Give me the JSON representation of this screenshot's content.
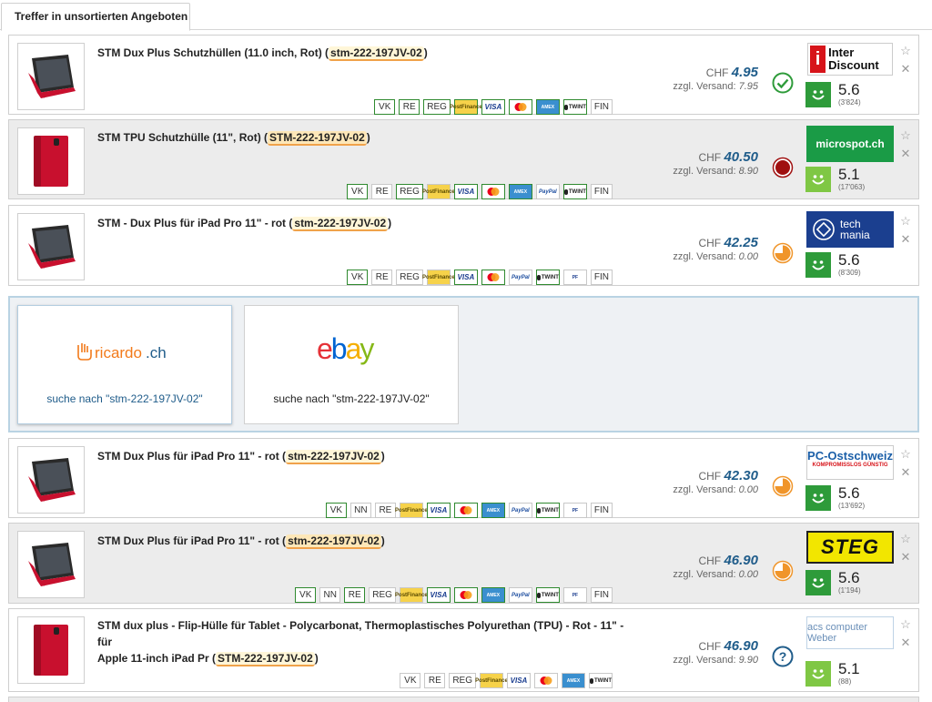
{
  "tab": {
    "label": "Treffer in unsortierten Angeboten"
  },
  "offers": [
    {
      "title": "STM Dux Plus Schutzhüllen (11.0 inch, Rot) (",
      "sku": "stm-222-197JV-02",
      "title_end": ")",
      "title_cont": "",
      "currency": "CHF",
      "price": "4.95",
      "shipping_label": "zzgl. Versand:",
      "shipping": "7.95",
      "status": "check",
      "shop": "Inter Discount",
      "rating": "5.6",
      "reviews": "(3'824)",
      "chips": [
        {
          "t": "VK",
          "g": true
        },
        {
          "t": "RE",
          "g": true
        },
        {
          "t": "REG",
          "g": true
        },
        {
          "t": "PostFinance",
          "c": "pp",
          "g": true
        },
        {
          "t": "VISA",
          "c": "visa",
          "g": true
        },
        {
          "t": "MC",
          "c": "mc",
          "g": true
        },
        {
          "t": "AMEX",
          "c": "ae",
          "g": true
        },
        {
          "t": "TWINT",
          "c": "tw",
          "g": true
        },
        {
          "t": "FIN",
          "g": false
        }
      ]
    },
    {
      "title": "STM TPU Schutzhülle (11\", Rot) (",
      "sku": "STM-222-197JV-02",
      "title_end": ")",
      "title_cont": "",
      "currency": "CHF",
      "price": "40.50",
      "shipping_label": "zzgl. Versand:",
      "shipping": "8.90",
      "status": "red",
      "shop": "microspot.ch",
      "rating": "5.1",
      "reviews": "(17'063)",
      "chips": [
        {
          "t": "VK",
          "g": true
        },
        {
          "t": "RE",
          "g": false
        },
        {
          "t": "REG",
          "g": true
        },
        {
          "t": "PostFinance",
          "c": "pp",
          "g": false
        },
        {
          "t": "VISA",
          "c": "visa",
          "g": true
        },
        {
          "t": "MC",
          "c": "mc",
          "g": true
        },
        {
          "t": "AMEX",
          "c": "ae",
          "g": true
        },
        {
          "t": "PayPal",
          "c": "pay",
          "g": false
        },
        {
          "t": "TWINT",
          "c": "tw",
          "g": true
        },
        {
          "t": "FIN",
          "g": false
        }
      ]
    },
    {
      "title": "STM - Dux Plus für iPad Pro 11\" - rot (",
      "sku": "stm-222-197JV-02",
      "title_end": ")",
      "title_cont": "",
      "currency": "CHF",
      "price": "42.25",
      "shipping_label": "zzgl. Versand:",
      "shipping": "0.00",
      "status": "orange",
      "shop": "tech mania",
      "rating": "5.6",
      "reviews": "(8'309)",
      "chips": [
        {
          "t": "VK",
          "g": true
        },
        {
          "t": "RE",
          "g": false
        },
        {
          "t": "REG",
          "g": false
        },
        {
          "t": "PostFinance",
          "c": "pp",
          "g": false
        },
        {
          "t": "VISA",
          "c": "visa",
          "g": true
        },
        {
          "t": "MC",
          "c": "mc",
          "g": true
        },
        {
          "t": "PayPal",
          "c": "pay",
          "g": false
        },
        {
          "t": "TWINT",
          "c": "tw",
          "g": true
        },
        {
          "t": "PF",
          "c": "pf",
          "g": false
        },
        {
          "t": "FIN",
          "g": false
        }
      ]
    },
    {
      "title": "STM Dux Plus für iPad Pro 11\" - rot (",
      "sku": "stm-222-197JV-02",
      "title_end": ")",
      "title_cont": "",
      "currency": "CHF",
      "price": "42.30",
      "shipping_label": "zzgl. Versand:",
      "shipping": "0.00",
      "status": "orange",
      "shop": "PC-Ostschweiz",
      "shop_sub": "KOMPROMISSLOS GÜNSTIG",
      "rating": "5.6",
      "reviews": "(13'692)",
      "chips": [
        {
          "t": "VK",
          "g": true
        },
        {
          "t": "NN",
          "g": false
        },
        {
          "t": "RE",
          "g": false
        },
        {
          "t": "PostFinance",
          "c": "pp",
          "g": false
        },
        {
          "t": "VISA",
          "c": "visa",
          "g": true
        },
        {
          "t": "MC",
          "c": "mc",
          "g": true
        },
        {
          "t": "AMEX",
          "c": "ae",
          "g": true
        },
        {
          "t": "PayPal",
          "c": "pay",
          "g": false
        },
        {
          "t": "TWINT",
          "c": "tw",
          "g": true
        },
        {
          "t": "PF",
          "c": "pf",
          "g": false
        },
        {
          "t": "FIN",
          "g": false
        }
      ]
    },
    {
      "title": "STM Dux Plus für iPad Pro 11\" - rot (",
      "sku": "stm-222-197JV-02",
      "title_end": ")",
      "title_cont": "",
      "currency": "CHF",
      "price": "46.90",
      "shipping_label": "zzgl. Versand:",
      "shipping": "0.00",
      "status": "orange",
      "shop": "STEG",
      "rating": "5.6",
      "reviews": "(1'194)",
      "chips": [
        {
          "t": "VK",
          "g": true
        },
        {
          "t": "NN",
          "g": false
        },
        {
          "t": "RE",
          "g": true
        },
        {
          "t": "REG",
          "g": false
        },
        {
          "t": "PostFinance",
          "c": "pp",
          "g": false
        },
        {
          "t": "VISA",
          "c": "visa",
          "g": true
        },
        {
          "t": "MC",
          "c": "mc",
          "g": true
        },
        {
          "t": "AMEX",
          "c": "ae",
          "g": true
        },
        {
          "t": "PayPal",
          "c": "pay",
          "g": false
        },
        {
          "t": "TWINT",
          "c": "tw",
          "g": true
        },
        {
          "t": "PF",
          "c": "pf",
          "g": false
        },
        {
          "t": "FIN",
          "g": false
        }
      ]
    },
    {
      "title": "STM dux plus - Flip-Hülle für Tablet - Polycarbonat, Thermoplastisches Polyurethan (TPU) - Rot - 11\" - für",
      "title_cont": "Apple 11-inch iPad Pr (",
      "sku": "STM-222-197JV-02",
      "title_end": ")",
      "currency": "CHF",
      "price": "46.90",
      "shipping_label": "zzgl. Versand:",
      "shipping": "9.90",
      "status": "question",
      "shop": "acs computer Weber",
      "rating": "5.1",
      "reviews": "(88)",
      "chips": [
        {
          "t": "VK",
          "g": false
        },
        {
          "t": "RE",
          "g": false
        },
        {
          "t": "REG",
          "g": false
        },
        {
          "t": "PostFinance",
          "c": "pp",
          "g": false
        },
        {
          "t": "VISA",
          "c": "visa",
          "g": false
        },
        {
          "t": "MC",
          "c": "mc",
          "g": false
        },
        {
          "t": "AMEX",
          "c": "ae",
          "g": false
        },
        {
          "t": "TWINT",
          "c": "tw",
          "g": false
        }
      ]
    }
  ],
  "external": {
    "ricardo": {
      "logo": "ricardo.ch",
      "query": "suche nach \"stm-222-197JV-02\""
    },
    "ebay": {
      "logo": "ebay",
      "query": "suche nach \"stm-222-197JV-02\""
    }
  },
  "colors": {
    "accent": "#1f5c8a",
    "rating_dark": "#2e9b3a",
    "rating_light": "#7fc744",
    "status_green": "#2e9b3a",
    "status_red": "#a01010",
    "status_orange": "#f0952a",
    "status_blue": "#1f5c8a"
  }
}
